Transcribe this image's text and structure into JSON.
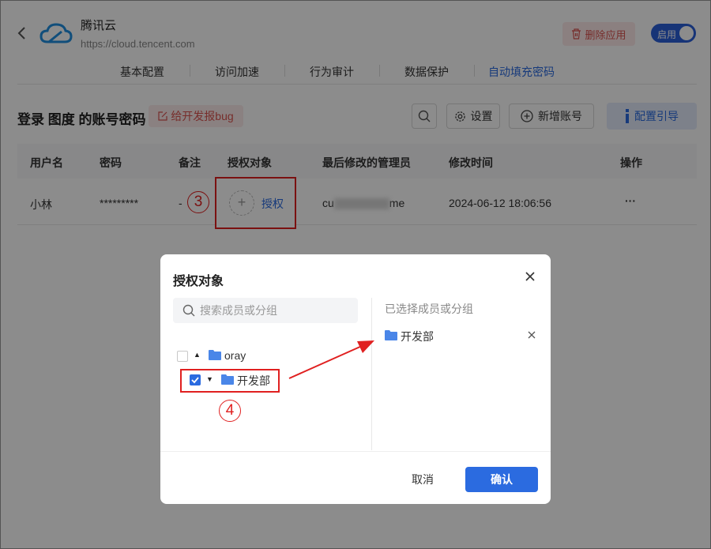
{
  "app": {
    "name": "腾讯云",
    "url": "https://cloud.tencent.com"
  },
  "header": {
    "delete_label": "删除应用",
    "toggle_label": "启用"
  },
  "tabs": [
    "基本配置",
    "访问加速",
    "行为审计",
    "数据保护",
    "自动填充密码"
  ],
  "toolbar": {
    "title": "登录 图度 的账号密码",
    "bug_label": "给开发报bug",
    "settings_label": "设置",
    "add_label": "新增账号",
    "guide_label": "配置引导"
  },
  "table": {
    "headers": [
      "用户名",
      "密码",
      "备注",
      "授权对象",
      "最后修改的管理员",
      "修改时间",
      "操作"
    ],
    "row": {
      "username": "小林",
      "password": "*********",
      "note": "-",
      "auth_label": "授权",
      "admin_prefix": "cu",
      "admin_suffix": "me",
      "time": "2024-06-12 18:06:56",
      "actions": "···"
    }
  },
  "annotations": {
    "step3": "3",
    "step4": "4"
  },
  "modal": {
    "title": "授权对象",
    "search_placeholder": "搜索成员或分组",
    "tree": [
      {
        "label": "oray",
        "checked": false
      },
      {
        "label": "开发部",
        "checked": true
      }
    ],
    "selected_title": "已选择成员或分组",
    "selected": [
      "开发部"
    ],
    "cancel_label": "取消",
    "ok_label": "确认"
  },
  "colors": {
    "accent": "#2b6be0",
    "danger": "#e02020",
    "folder": "#4a86e8"
  }
}
